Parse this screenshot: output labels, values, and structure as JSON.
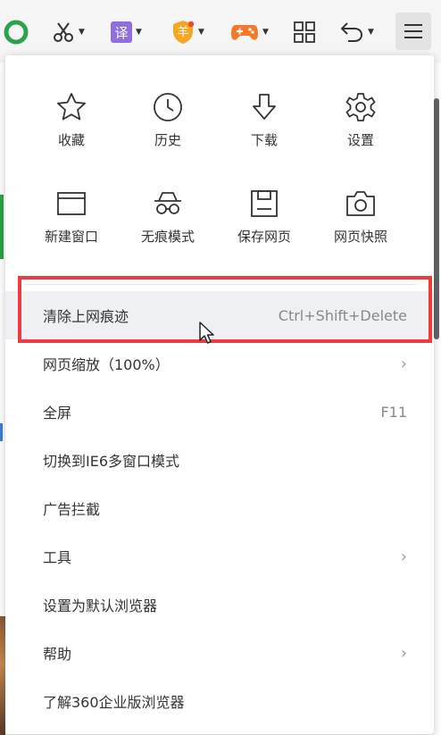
{
  "toolbar": {
    "icons": [
      "browser-logo-icon",
      "scissors-icon",
      "translate-icon",
      "shield-icon",
      "game-icon",
      "apps-grid-icon",
      "undo-icon",
      "menu-icon"
    ],
    "translate_char": "译",
    "shield_char": "羊"
  },
  "menu": {
    "grid": [
      {
        "label": "收藏",
        "icon": "star-icon"
      },
      {
        "label": "历史",
        "icon": "clock-icon"
      },
      {
        "label": "下载",
        "icon": "download-icon"
      },
      {
        "label": "设置",
        "icon": "gear-icon"
      },
      {
        "label": "新建窗口",
        "icon": "window-icon"
      },
      {
        "label": "无痕模式",
        "icon": "incognito-icon"
      },
      {
        "label": "保存网页",
        "icon": "save-icon"
      },
      {
        "label": "网页快照",
        "icon": "camera-icon"
      }
    ],
    "items": [
      {
        "label": "清除上网痕迹",
        "shortcut": "Ctrl+Shift+Delete"
      },
      {
        "label": "网页缩放（100%）"
      },
      {
        "label": "全屏",
        "shortcut": "F11"
      },
      {
        "label": "切换到IE6多窗口模式"
      },
      {
        "label": "广告拦截"
      },
      {
        "label": "工具"
      },
      {
        "label": "设置为默认浏览器"
      },
      {
        "label": "帮助"
      },
      {
        "label": "了解360企业版浏览器"
      }
    ],
    "chevron": "›"
  },
  "colors": {
    "highlight": "#ee3b3b",
    "hover_row": "#eef0f4",
    "logo_green": "#2aa34a",
    "translate_purple": "#8f6fe0",
    "shield_orange": "#f5a623",
    "game_orange": "#f47a2a"
  }
}
